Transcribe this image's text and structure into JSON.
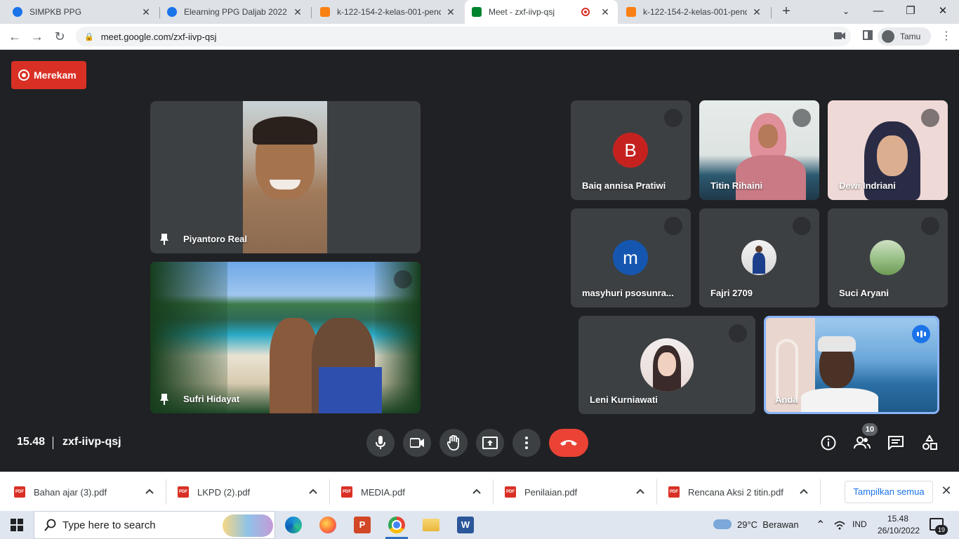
{
  "browser": {
    "tabs": [
      {
        "title": "SIMPKB PPG",
        "favicon_color": "#1a73e8"
      },
      {
        "title": "Elearning PPG Daljab 2022",
        "favicon_color": "#1a73e8"
      },
      {
        "title": "k-122-154-2-kelas-001-pend",
        "favicon_color": "#f98012"
      },
      {
        "title": "Meet - zxf-iivp-qsj",
        "favicon_color": "#00832d",
        "active": true
      },
      {
        "title": "k-122-154-2-kelas-001-pend",
        "favicon_color": "#f98012"
      }
    ],
    "url": "meet.google.com/zxf-iivp-qsj",
    "profile_label": "Tamu"
  },
  "meet": {
    "recording_label": "Merekam",
    "time": "15.48",
    "meeting_code": "zxf-iivp-qsj",
    "participants_count": "10",
    "participants": [
      {
        "name": "Piyantoro Real",
        "type": "video",
        "pinned": true
      },
      {
        "name": "Sufri Hidayat",
        "type": "video",
        "pinned": true,
        "muted": true
      },
      {
        "name": "Baiq annisa Pratiwi",
        "type": "initial",
        "initial": "B",
        "color": "#c5221f",
        "muted": true
      },
      {
        "name": "Titin Rihaini",
        "type": "video",
        "muted": true
      },
      {
        "name": "Dewi Indriani",
        "type": "video",
        "muted": true
      },
      {
        "name": "masyhuri psosunra...",
        "type": "initial",
        "initial": "m",
        "color": "#1557b0",
        "muted": true
      },
      {
        "name": "Fajri 2709",
        "type": "photo",
        "muted": true
      },
      {
        "name": "Suci Aryani",
        "type": "photo",
        "muted": true
      },
      {
        "name": "Leni Kurniawati",
        "type": "photo",
        "muted": true
      },
      {
        "name": "Anda",
        "type": "video",
        "speaking": true
      }
    ]
  },
  "downloads": {
    "items": [
      "Bahan ajar (3).pdf",
      "LKPD (2).pdf",
      "MEDIA.pdf",
      "Penilaian.pdf",
      "Rencana Aksi 2 titin.pdf"
    ],
    "file_icon_label": "PDF",
    "show_all_label": "Tampilkan semua"
  },
  "taskbar": {
    "search_placeholder": "Type here to search",
    "weather": "29°C  Berawan",
    "language": "IND",
    "time": "15.48",
    "date": "26/10/2022",
    "notification_count": "19"
  },
  "colors": {
    "meet_bg": "#202124",
    "tile_bg": "#3c4043",
    "record_red": "#d93025",
    "end_call_red": "#ea4335",
    "speaking_blue": "#8ab4f8",
    "link_blue": "#1a73e8"
  }
}
